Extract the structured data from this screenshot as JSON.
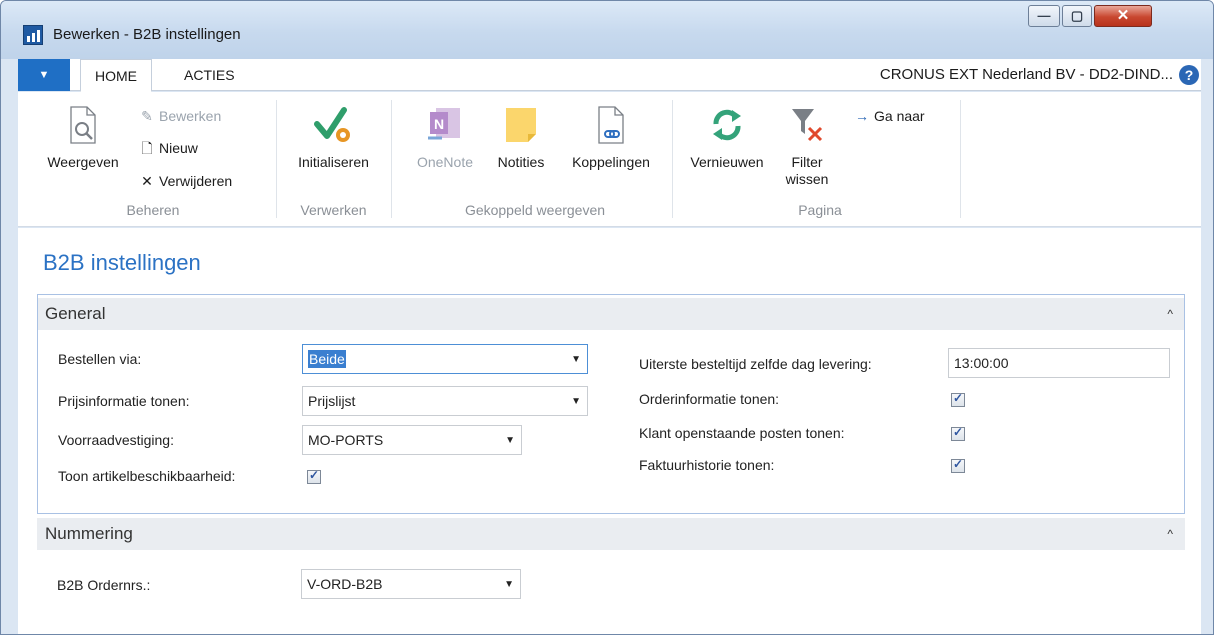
{
  "window": {
    "title": "Bewerken - B2B instellingen",
    "min_glyph": "—",
    "max_glyph": "▢",
    "close_glyph": "✕"
  },
  "ribbon_tabs": {
    "file_glyph": "▼",
    "tabs": [
      {
        "label": "HOME"
      },
      {
        "label": "ACTIES"
      }
    ],
    "company": "CRONUS EXT Nederland BV - DD2-DIND...",
    "help_glyph": "?"
  },
  "ribbon": {
    "groups": {
      "beheren": {
        "label": "Beheren",
        "weergeven": "Weergeven",
        "bewerken": "Bewerken",
        "nieuw": "Nieuw",
        "verwijderen": "Verwijderen"
      },
      "verwerken": {
        "label": "Verwerken",
        "initialiseren": "Initialiseren"
      },
      "gekoppeld": {
        "label": "Gekoppeld weergeven",
        "onenote": "OneNote",
        "notities": "Notities",
        "koppelingen": "Koppelingen"
      },
      "pagina": {
        "label": "Pagina",
        "vernieuwen": "Vernieuwen",
        "filter_line1": "Filter",
        "filter_line2": "wissen",
        "ga_naar": "Ga naar"
      }
    }
  },
  "page": {
    "title": "B2B instellingen"
  },
  "general": {
    "title": "General",
    "chevron": "^",
    "bestellen_via": {
      "label": "Bestellen via:",
      "value": "Beide"
    },
    "prijsinformatie": {
      "label": "Prijsinformatie tonen:",
      "value": "Prijslijst"
    },
    "voorraadvestiging": {
      "label": "Voorraadvestiging:",
      "value": "MO-PORTS"
    },
    "toon_artikel": {
      "label": "Toon artikelbeschikbaarheid:",
      "checked": true
    },
    "uiterste_besteltijd": {
      "label": "Uiterste besteltijd zelfde dag levering:",
      "value": "13:00:00"
    },
    "orderinformatie": {
      "label": "Orderinformatie tonen:",
      "checked": true
    },
    "klant_posten": {
      "label": "Klant openstaande posten tonen:",
      "checked": true
    },
    "faktuurhistorie": {
      "label": "Faktuurhistorie tonen:",
      "checked": true
    },
    "check_glyph": "✓",
    "dropdown_glyph": "▼"
  },
  "nummering": {
    "title": "Nummering",
    "chevron": "^",
    "b2b_ordernrs": {
      "label": "B2B Ordernrs.:",
      "value": "V-ORD-B2B"
    }
  }
}
